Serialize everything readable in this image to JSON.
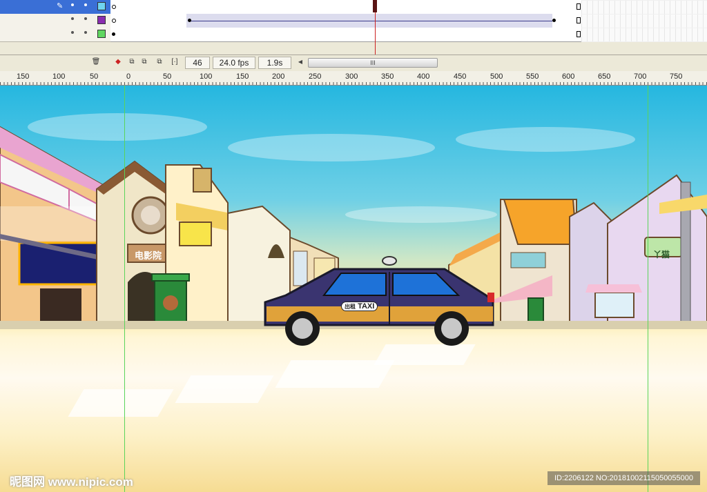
{
  "timeline": {
    "layers": [
      {
        "name": "",
        "outline_color": "#6fd3f0",
        "selected": true
      },
      {
        "name": "",
        "outline_color": "#8a2db0",
        "selected": false
      },
      {
        "name": "",
        "outline_color": "#5fd65f",
        "selected": false
      }
    ],
    "status": {
      "current_frame": "46",
      "frame_rate": "24.0 fps",
      "elapsed_time": "1.9s",
      "scroll_thumb_grip": "III"
    }
  },
  "ruler": {
    "labels": [
      "150",
      "100",
      "50",
      "0",
      "50",
      "100",
      "150",
      "200",
      "250",
      "300",
      "350",
      "400",
      "450",
      "500",
      "550",
      "600",
      "650",
      "700",
      "750"
    ]
  },
  "stage": {
    "sign_cinema": "电影院",
    "sign_shop": "丫猫",
    "taxi_roof_text": "出租",
    "taxi_text": "TAXI",
    "taxi_body_color": "#3a3470",
    "taxi_stripe_color": "#e0a23a",
    "taxi_window_color": "#1e72d8"
  },
  "watermarks": {
    "left": "昵图网 www.nipic.com",
    "right": "ID:2206122 NO:20181002115050055000"
  }
}
